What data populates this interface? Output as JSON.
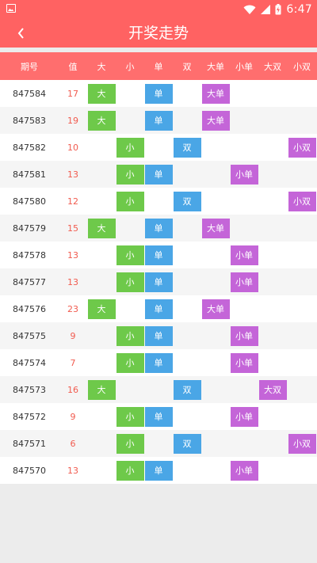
{
  "status_bar": {
    "time": "6:47"
  },
  "app_bar": {
    "title": "开奖走势"
  },
  "columns": [
    "期号",
    "值",
    "大",
    "小",
    "单",
    "双",
    "大单",
    "小单",
    "大双",
    "小双"
  ],
  "colors": {
    "big": "#6ec94a",
    "small": "#6ec94a",
    "odd": "#4aa6e6",
    "even": "#4aa6e6",
    "combo": "#c465d8",
    "value_text": "#f15b4f",
    "accent": "#ff6262"
  },
  "rows": [
    {
      "period": "847584",
      "value": "17",
      "marks": [
        "大",
        "",
        "单",
        "",
        "大单",
        "",
        "",
        ""
      ]
    },
    {
      "period": "847583",
      "value": "19",
      "marks": [
        "大",
        "",
        "单",
        "",
        "大单",
        "",
        "",
        ""
      ]
    },
    {
      "period": "847582",
      "value": "10",
      "marks": [
        "",
        "小",
        "",
        "双",
        "",
        "",
        "",
        "小双"
      ]
    },
    {
      "period": "847581",
      "value": "13",
      "marks": [
        "",
        "小",
        "单",
        "",
        "",
        "小单",
        "",
        ""
      ]
    },
    {
      "period": "847580",
      "value": "12",
      "marks": [
        "",
        "小",
        "",
        "双",
        "",
        "",
        "",
        "小双"
      ]
    },
    {
      "period": "847579",
      "value": "15",
      "marks": [
        "大",
        "",
        "单",
        "",
        "大单",
        "",
        "",
        ""
      ]
    },
    {
      "period": "847578",
      "value": "13",
      "marks": [
        "",
        "小",
        "单",
        "",
        "",
        "小单",
        "",
        ""
      ]
    },
    {
      "period": "847577",
      "value": "13",
      "marks": [
        "",
        "小",
        "单",
        "",
        "",
        "小单",
        "",
        ""
      ]
    },
    {
      "period": "847576",
      "value": "23",
      "marks": [
        "大",
        "",
        "单",
        "",
        "大单",
        "",
        "",
        ""
      ]
    },
    {
      "period": "847575",
      "value": "9",
      "marks": [
        "",
        "小",
        "单",
        "",
        "",
        "小单",
        "",
        ""
      ]
    },
    {
      "period": "847574",
      "value": "7",
      "marks": [
        "",
        "小",
        "单",
        "",
        "",
        "小单",
        "",
        ""
      ]
    },
    {
      "period": "847573",
      "value": "16",
      "marks": [
        "大",
        "",
        "",
        "双",
        "",
        "",
        "大双",
        ""
      ]
    },
    {
      "period": "847572",
      "value": "9",
      "marks": [
        "",
        "小",
        "单",
        "",
        "",
        "小单",
        "",
        ""
      ]
    },
    {
      "period": "847571",
      "value": "6",
      "marks": [
        "",
        "小",
        "",
        "双",
        "",
        "",
        "",
        "小双"
      ]
    },
    {
      "period": "847570",
      "value": "13",
      "marks": [
        "",
        "小",
        "单",
        "",
        "",
        "小单",
        "",
        ""
      ]
    }
  ]
}
